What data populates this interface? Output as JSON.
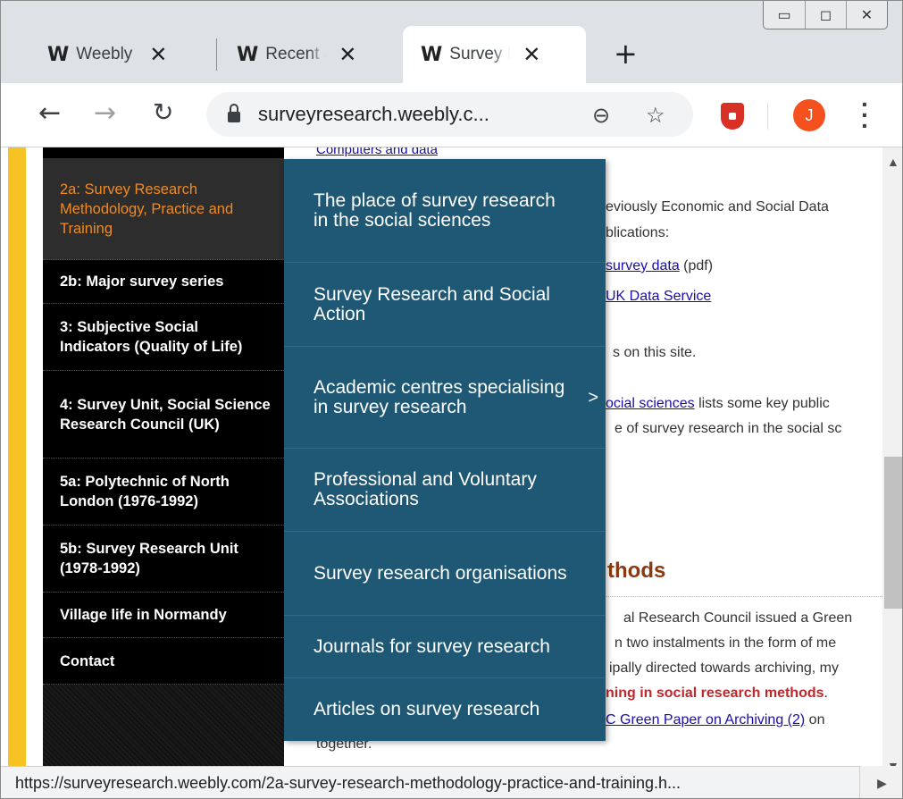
{
  "tabs": [
    {
      "label": "Weebly",
      "logo": "W"
    },
    {
      "label": "Recent activity",
      "logo": "W"
    },
    {
      "label": "Survey Research",
      "logo": "W"
    }
  ],
  "toolbar": {
    "url": "surveyresearch.weebly.c...",
    "avatar_letter": "J"
  },
  "sidebar": {
    "items": [
      {
        "label": "2a: Survey Research Methodology, Practice and Training",
        "active": true
      },
      {
        "label": "2b: Major survey series"
      },
      {
        "label": "3: Subjective Social Indicators (Quality of Life)"
      },
      {
        "label": "4: Survey Unit, Social Science Research Council (UK)"
      },
      {
        "label": "5a: Polytechnic of North London (1976-1992)"
      },
      {
        "label": "5b: Survey Research Unit (1978-1992)"
      },
      {
        "label": "Village life in Normandy"
      },
      {
        "label": "Contact"
      }
    ]
  },
  "dropdown": {
    "items": [
      {
        "label": "The place of survey research in the social sciences"
      },
      {
        "label": "Survey Research and Social Action"
      },
      {
        "label": "Academic centres specialising in survey research",
        "has_submenu": true
      },
      {
        "label": "Professional and Voluntary Associations"
      },
      {
        "label": "Survey research organisations"
      },
      {
        "label": "Journals for survey research"
      },
      {
        "label": "Articles on survey research"
      }
    ]
  },
  "article": {
    "top_link": "Computers and data",
    "line1": "eviously Economic and Social Data",
    "line2": "blications:",
    "link_survey_data": "survey data",
    "pdf": "(pdf)",
    "link_uk_data": "UK Data Service",
    "line3": "s on this site.",
    "link_social_sciences": "ocial sciences",
    "line4_rest": "lists some key public",
    "line5": "e of survey research in the social sc",
    "heading": "thods",
    "line6": "al Research Council issued a Green",
    "line7": "n two instalments in the form of me",
    "line8": "ipally directed towards archiving, my",
    "red_text": "ning in social research methods",
    "red_dot": ".",
    "link_green_paper": "C Green Paper on Archiving (2)",
    "line9_rest": "on",
    "line10": "together."
  },
  "status_url": "https://surveyresearch.weebly.com/2a-survey-research-methodology-practice-and-training.h..."
}
